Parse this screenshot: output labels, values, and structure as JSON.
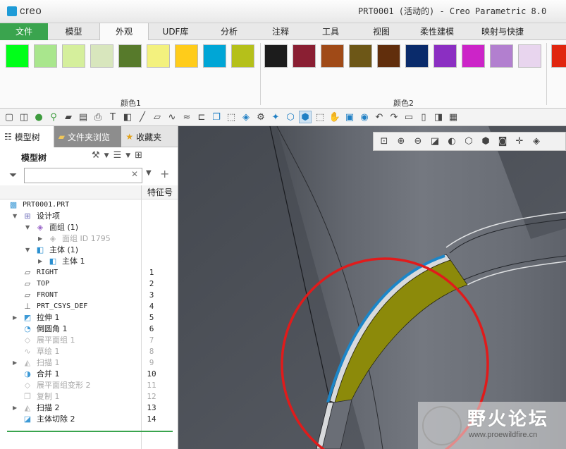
{
  "app": {
    "logo_text": "creo",
    "window_title": "PRT0001 (活动的) - Creo Parametric 8.0"
  },
  "ribbon_tabs": [
    {
      "label": "文件"
    },
    {
      "label": "模型"
    },
    {
      "label": "外观"
    },
    {
      "label": "UDF库"
    },
    {
      "label": "分析"
    },
    {
      "label": "注释"
    },
    {
      "label": "工具"
    },
    {
      "label": "视图"
    },
    {
      "label": "柔性建模"
    },
    {
      "label": "映射与快捷"
    }
  ],
  "active_tab": "外观",
  "colors1": {
    "label": "颜色1",
    "swatches": [
      "#00ff19",
      "#a9e68d",
      "#d5ef9c",
      "#d8e6bd",
      "#577a2b",
      "#f3f17e",
      "#ffcc1a",
      "#00a6d6",
      "#b5c01a"
    ]
  },
  "colors2": {
    "label": "颜色2",
    "swatches": [
      "#1c1c1c",
      "#8a1f33",
      "#a04a17",
      "#6d5717",
      "#612e0c",
      "#0a2b6b",
      "#8b2fc2",
      "#cc24c8",
      "#b27fcf",
      "#e8d5ee"
    ]
  },
  "colors3_partial": [
    "#e0260f"
  ],
  "nav_tabs": [
    {
      "label": "模型树",
      "icon": "tree-icon"
    },
    {
      "label": "文件夹浏览",
      "icon": "folder-icon"
    },
    {
      "label": "收藏夹",
      "icon": "star-icon"
    }
  ],
  "model_tree": {
    "title": "模型树",
    "search_placeholder": "",
    "column_header": "特征号",
    "rows": [
      {
        "label": "PRT0001.PRT",
        "num": "",
        "indent": 0,
        "expander": "",
        "icon": "part-icon",
        "muted": false,
        "mono": true
      },
      {
        "label": "设计项",
        "num": "",
        "indent": 1,
        "expander": "▼",
        "icon": "design-items-icon",
        "muted": false,
        "mono": false
      },
      {
        "label": "面组 (1)",
        "num": "",
        "indent": 2,
        "expander": "▼",
        "icon": "quilt-icon",
        "muted": false,
        "mono": false
      },
      {
        "label": "面组 ID 1795",
        "num": "",
        "indent": 3,
        "expander": "▶",
        "icon": "quilt-icon",
        "muted": true,
        "mono": false
      },
      {
        "label": "主体 (1)",
        "num": "",
        "indent": 2,
        "expander": "▼",
        "icon": "body-icon",
        "muted": false,
        "mono": false
      },
      {
        "label": "主体 1",
        "num": "",
        "indent": 3,
        "expander": "▶",
        "icon": "body-icon",
        "muted": false,
        "mono": false
      },
      {
        "label": "RIGHT",
        "num": "1",
        "indent": 1,
        "expander": "",
        "icon": "datum-plane-icon",
        "muted": false,
        "mono": true
      },
      {
        "label": "TOP",
        "num": "2",
        "indent": 1,
        "expander": "",
        "icon": "datum-plane-icon",
        "muted": false,
        "mono": true
      },
      {
        "label": "FRONT",
        "num": "3",
        "indent": 1,
        "expander": "",
        "icon": "datum-plane-icon",
        "muted": false,
        "mono": true
      },
      {
        "label": "PRT_CSYS_DEF",
        "num": "4",
        "indent": 1,
        "expander": "",
        "icon": "csys-icon",
        "muted": false,
        "mono": true
      },
      {
        "label": "拉伸 1",
        "num": "5",
        "indent": 1,
        "expander": "▶",
        "icon": "extrude-icon",
        "muted": false,
        "mono": false
      },
      {
        "label": "倒圆角 1",
        "num": "6",
        "indent": 1,
        "expander": "",
        "icon": "round-icon",
        "muted": false,
        "mono": false
      },
      {
        "label": "展平面组 1",
        "num": "7",
        "indent": 1,
        "expander": "",
        "icon": "flatten-icon",
        "muted": true,
        "mono": false
      },
      {
        "label": "草绘 1",
        "num": "8",
        "indent": 1,
        "expander": "",
        "icon": "sketch-icon",
        "muted": true,
        "mono": false
      },
      {
        "label": "扫描 1",
        "num": "9",
        "indent": 1,
        "expander": "▶",
        "icon": "sweep-icon",
        "muted": true,
        "mono": false
      },
      {
        "label": "合并 1",
        "num": "10",
        "indent": 1,
        "expander": "",
        "icon": "merge-icon",
        "muted": false,
        "mono": false
      },
      {
        "label": "展平面组变形 2",
        "num": "11",
        "indent": 1,
        "expander": "",
        "icon": "flatten-icon",
        "muted": true,
        "mono": false
      },
      {
        "label": "复制 1",
        "num": "12",
        "indent": 1,
        "expander": "",
        "icon": "copy-icon",
        "muted": true,
        "mono": false
      },
      {
        "label": "扫描 2",
        "num": "13",
        "indent": 1,
        "expander": "▶",
        "icon": "sweep-icon",
        "muted": false,
        "mono": false
      },
      {
        "label": "主体切除 2",
        "num": "14",
        "indent": 1,
        "expander": "",
        "icon": "body-cut-icon",
        "muted": false,
        "mono": false
      }
    ]
  },
  "toolbar_icons": [
    "new-icon",
    "open-icon",
    "appearance-icon",
    "display-icon",
    "folder-icon",
    "save-icon",
    "print-icon",
    "text-icon",
    "model-icon",
    "line-icon",
    "plane-icon",
    "spline-icon",
    "curve-icon",
    "dimension-icon",
    "copy-icon",
    "select-icon",
    "render-icon",
    "tools-icon",
    "pin-icon",
    "cube-icon",
    "cube-selected-icon",
    "select-box-icon",
    "pan-icon",
    "layer-icon",
    "globe-icon",
    "undo-icon",
    "redo-icon",
    "window-icon",
    "page-icon",
    "layout-icon",
    "settings-icon"
  ],
  "view_toolbar_icons": [
    "zoom-fit-icon",
    "zoom-in-icon",
    "zoom-out-icon",
    "repaint-icon",
    "shade-icon",
    "view-cube-icon",
    "saved-views-icon",
    "camera-icon",
    "spin-center-icon",
    "view-display-icon"
  ],
  "watermark": {
    "title": "野火论坛",
    "url": "www.proewildfire.cn"
  }
}
